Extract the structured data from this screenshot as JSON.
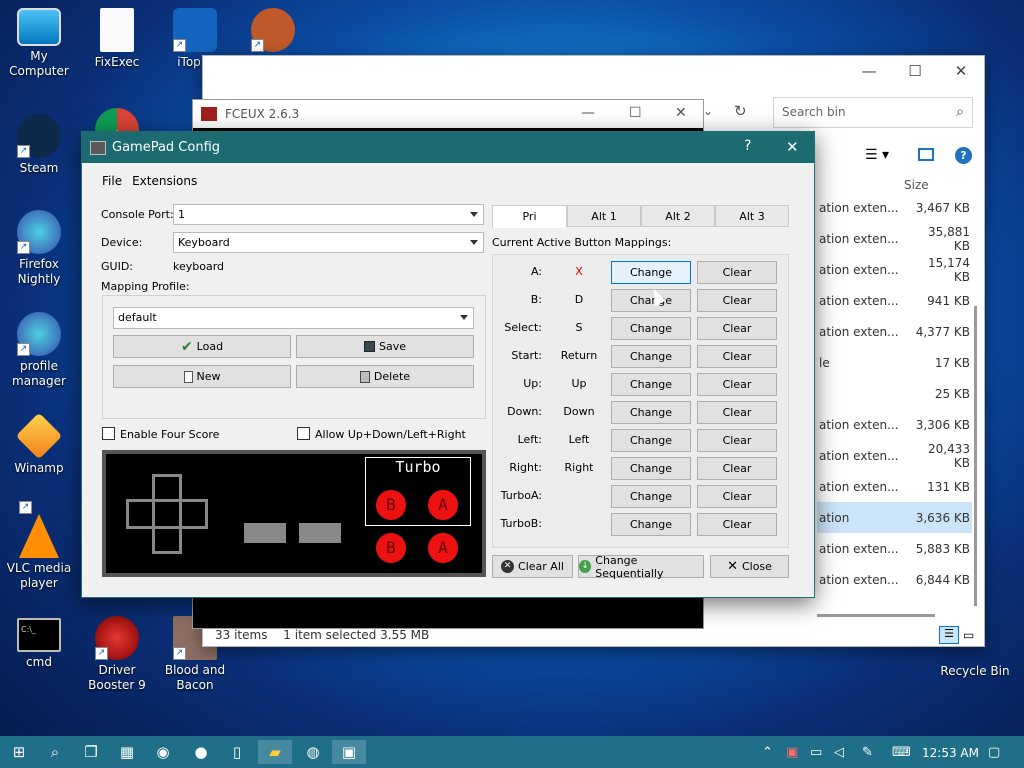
{
  "desktop": {
    "icons": [
      {
        "label": "My Computer",
        "icon": "monitor-icon"
      },
      {
        "label": "FixExec",
        "icon": "document-icon"
      },
      {
        "label": "iTop V",
        "icon": "shield-icon"
      },
      {
        "label": "Steam",
        "icon": "steam-icon"
      },
      {
        "label": "Firefox Nightly",
        "icon": "firefox-icon"
      },
      {
        "label": "profile manager",
        "icon": "firefox-icon"
      },
      {
        "label": "Winamp",
        "icon": "winamp-icon"
      },
      {
        "label": "VLC media player",
        "icon": "vlc-icon"
      },
      {
        "label": "cmd",
        "icon": "terminal-icon"
      },
      {
        "label": "Driver Booster 9",
        "icon": "gear-icon"
      },
      {
        "label": "Blood and Bacon",
        "icon": "game-icon"
      },
      {
        "label": "Recycle Bin",
        "icon": "recycle-icon"
      }
    ]
  },
  "explorer": {
    "search_placeholder": "Search bin",
    "size_header": "Size",
    "files": [
      {
        "name": "ation exten...",
        "size": "3,467 KB"
      },
      {
        "name": "ation exten...",
        "size": "35,881 KB"
      },
      {
        "name": "ation exten...",
        "size": "15,174 KB"
      },
      {
        "name": "ation exten...",
        "size": "941 KB"
      },
      {
        "name": "ation exten...",
        "size": "4,377 KB"
      },
      {
        "name": "le",
        "size": "17 KB"
      },
      {
        "name": "",
        "size": "25 KB"
      },
      {
        "name": "ation exten...",
        "size": "3,306 KB"
      },
      {
        "name": "ation exten...",
        "size": "20,433 KB"
      },
      {
        "name": "ation exten...",
        "size": "131 KB"
      },
      {
        "name": "ation",
        "size": "3,636 KB"
      },
      {
        "name": "ation exten...",
        "size": "5,883 KB"
      },
      {
        "name": "ation exten...",
        "size": "6,844 KB"
      }
    ],
    "status_items": "33 items",
    "status_selected": "1 item selected  3.55 MB"
  },
  "fceux": {
    "title": "FCEUX 2.6.3"
  },
  "dialog": {
    "title": "GamePad Config",
    "help": "?",
    "close": "✕",
    "menu": {
      "file": "File",
      "extensions": "Extensions"
    },
    "console_port_label": "Console Port:",
    "console_port_value": "1",
    "device_label": "Device:",
    "device_value": "Keyboard",
    "guid_label": "GUID:",
    "guid_value": "keyboard",
    "mapping_profile_label": "Mapping Profile:",
    "profile_value": "default",
    "load": "Load",
    "save": "Save",
    "new": "New",
    "delete": "Delete",
    "enable_four_score": "Enable Four Score",
    "allow_updown": "Allow Up+Down/Left+Right",
    "turbo_label": "Turbo",
    "btn_b": "B",
    "btn_a": "A",
    "tabs": [
      "Pri",
      "Alt 1",
      "Alt 2",
      "Alt 3"
    ],
    "mappings_label": "Current Active Button Mappings:",
    "change_label": "Change",
    "clear_label": "Clear",
    "mappings": [
      {
        "key": "A:",
        "value": "X",
        "red": true
      },
      {
        "key": "B:",
        "value": "D",
        "red": false
      },
      {
        "key": "Select:",
        "value": "S",
        "red": false
      },
      {
        "key": "Start:",
        "value": "Return",
        "red": false
      },
      {
        "key": "Up:",
        "value": "Up",
        "red": false
      },
      {
        "key": "Down:",
        "value": "Down",
        "red": false
      },
      {
        "key": "Left:",
        "value": "Left",
        "red": false
      },
      {
        "key": "Right:",
        "value": "Right",
        "red": false
      },
      {
        "key": "TurboA:",
        "value": "",
        "red": false
      },
      {
        "key": "TurboB:",
        "value": "",
        "red": false
      }
    ],
    "clear_all": "Clear All",
    "change_sequentially": "Change Sequentially",
    "close_button": "Close"
  },
  "taskbar": {
    "time": "12:53 AM"
  },
  "colors": {
    "dialog_title": "#1c6b70",
    "taskbar": "#1f6f89",
    "mapping_red": "#e00000"
  }
}
